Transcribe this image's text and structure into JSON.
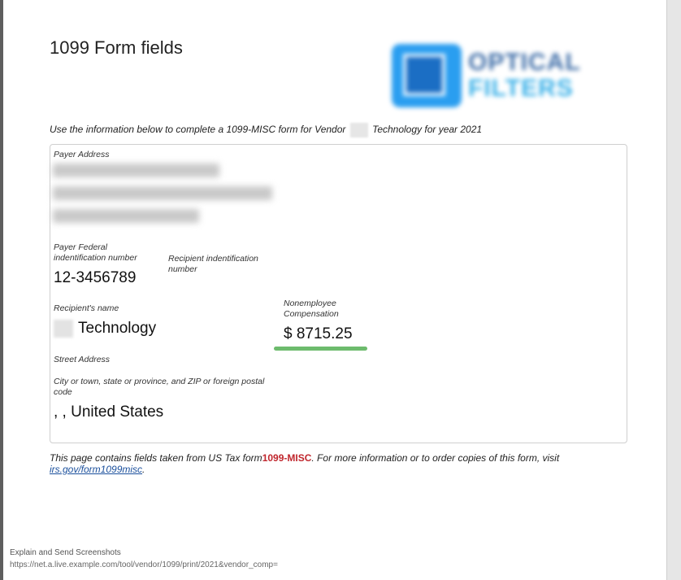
{
  "page_title": "1099 Form fields",
  "intro": {
    "prefix": "Use the information below to complete a 1099-MISC form for Vendor",
    "suffix": "Technology for year 2021"
  },
  "logo": {
    "line1": "OPTICAL",
    "line2": "FILTERS"
  },
  "fields": {
    "payer_address_label": "Payer Address",
    "payer_tin_label": "Payer Federal indentification number",
    "payer_tin_value": "12-3456789",
    "recipient_tin_label": "Recipient indentification number",
    "recipient_name_label": "Recipient's name",
    "recipient_name_value": "Technology",
    "compensation_label": "Nonemployee Compensation",
    "compensation_value": "$ 8715.25",
    "street_label": "Street Address",
    "city_label": "City or town, state or province, and ZIP or foreign postal code",
    "city_value": ", , United States"
  },
  "footer": {
    "prefix": "This page contains fields taken from US Tax form",
    "form_name": "1099-MISC",
    "middle": ". For more information or to order copies of this form, visit",
    "link": "irs.gov/form1099misc",
    "end": "."
  },
  "overlay": {
    "line1": "Explain and Send Screenshots",
    "line2": "https://net.a.live.example.com/tool/vendor/1099/print/2021&vendor_comp="
  },
  "colors": {
    "form_name": "#c0262d",
    "link": "#1a4f9c",
    "highlight": "#6dbb6d",
    "logo_primary": "#2a9ef0"
  }
}
